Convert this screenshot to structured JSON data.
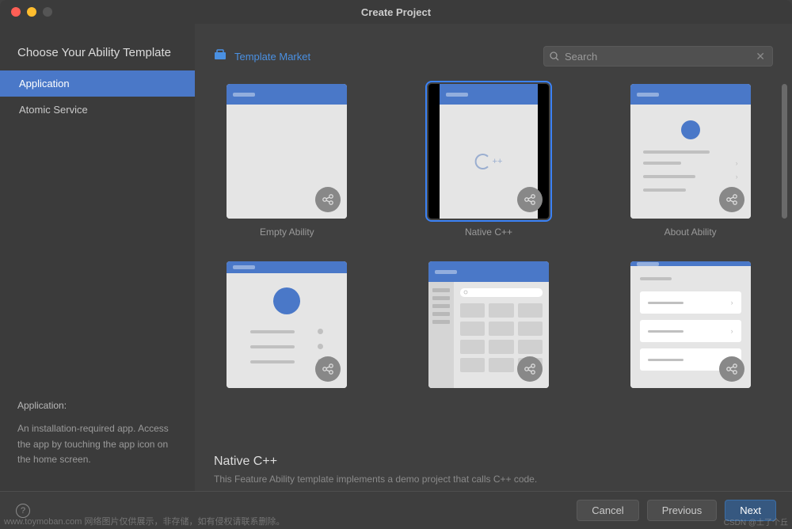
{
  "window": {
    "title": "Create Project"
  },
  "heading": "Choose Your Ability Template",
  "sidebar": {
    "items": [
      {
        "label": "Application",
        "active": true
      },
      {
        "label": "Atomic Service",
        "active": false
      }
    ],
    "desc_title": "Application:",
    "desc_text": "An installation-required app. Access the app by touching the app icon on the home screen."
  },
  "toolbar": {
    "market_label": "Template Market",
    "search_placeholder": "Search"
  },
  "templates": [
    {
      "label": "Empty Ability",
      "kind": "empty"
    },
    {
      "label": "Native C++",
      "kind": "cpp",
      "selected": true
    },
    {
      "label": "About Ability",
      "kind": "about"
    },
    {
      "label": "",
      "kind": "profile"
    },
    {
      "label": "",
      "kind": "grid"
    },
    {
      "label": "",
      "kind": "list"
    }
  ],
  "detail": {
    "title": "Native C++",
    "description": "This Feature Ability template implements a demo project that calls C++ code."
  },
  "footer": {
    "cancel": "Cancel",
    "previous": "Previous",
    "next": "Next"
  },
  "watermark": {
    "left": "www.toymoban.com 网络图片仅供展示，非存储，如有侵权请联系删除。",
    "right": "CSDN @土了个丘"
  }
}
